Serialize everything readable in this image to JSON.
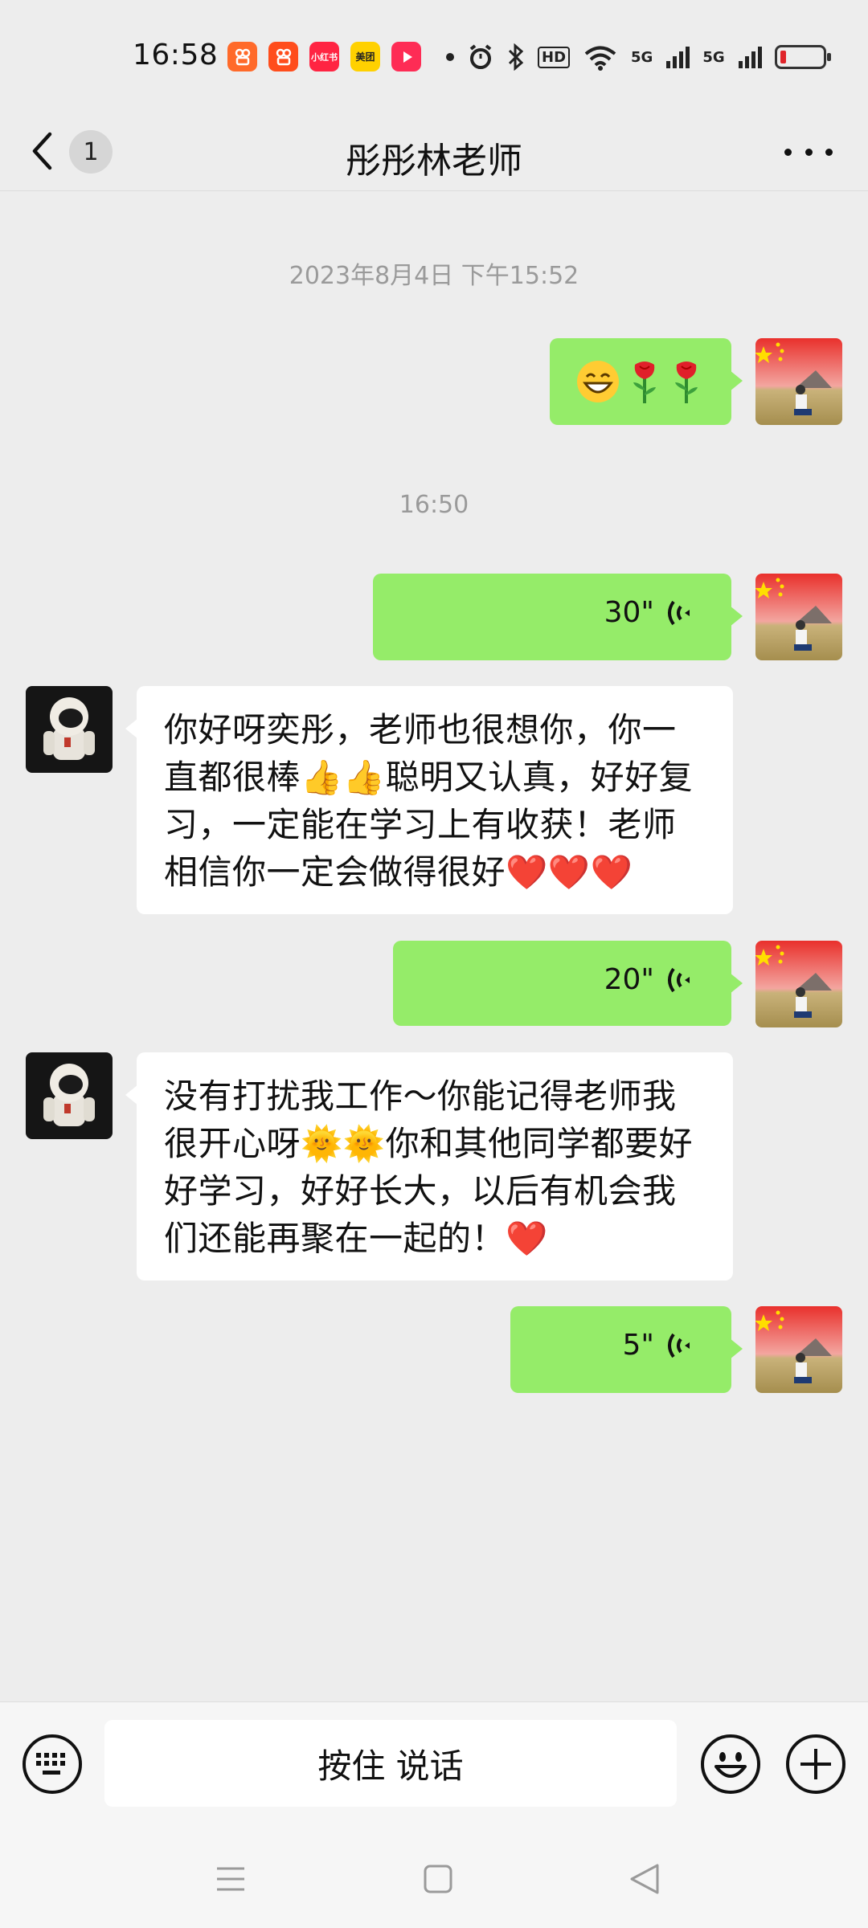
{
  "status_bar": {
    "time": "16:58",
    "apps": [
      {
        "name": "kuaishou-app-icon",
        "color": "#ff6a2a",
        "label": ""
      },
      {
        "name": "kuaishou-speed-app-icon",
        "color": "#ff4d1c",
        "label": ""
      },
      {
        "name": "xiaohongshu-app-icon",
        "color": "#ff2442",
        "label": "小红书"
      },
      {
        "name": "meituan-app-icon",
        "color": "#ffd100",
        "label": "美团"
      },
      {
        "name": "video-app-icon",
        "color": "#fe2c55",
        "label": ""
      }
    ],
    "network_label": "5G",
    "hd_label": "HD",
    "battery_color": "#e0242a"
  },
  "header": {
    "unread_count": "1",
    "title": "彤彤林老师"
  },
  "messages": {
    "ts1": "2023年8月4日 下午15:52",
    "ts2": "16:50",
    "voice1": "30\"",
    "incoming1": "你好呀奕彤，老师也很想你，你一直都很棒👍👍聪明又认真，好好复习，一定能在学习上有收获！老师相信你一定会做得很好❤️❤️❤️",
    "voice2": "20\"",
    "incoming2": "没有打扰我工作～你能记得老师我很开心呀🌞🌞你和其他同学都要好好学习，好好长大，以后有机会我们还能再聚在一起的！❤️",
    "voice3": "5\""
  },
  "input_bar": {
    "hold_to_talk": "按住 说话"
  },
  "colors": {
    "background": "#ededed",
    "my_bubble": "#95ec69",
    "their_bubble": "#ffffff",
    "timestamp": "#9a9a9a"
  }
}
